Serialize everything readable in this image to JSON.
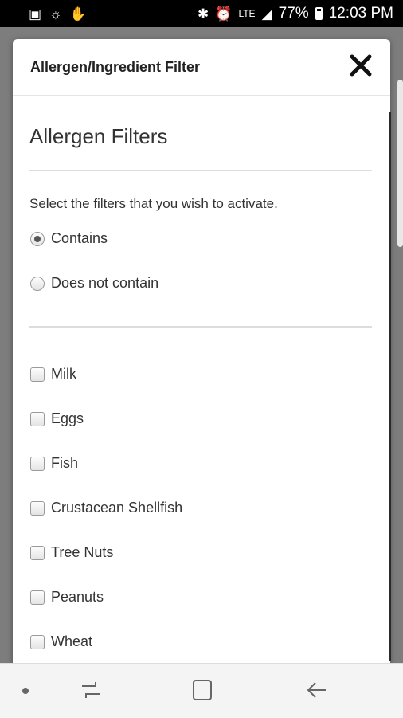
{
  "status_bar": {
    "battery_text": "77%",
    "time": "12:03 PM",
    "network": "LTE"
  },
  "modal": {
    "title": "Allergen/Ingredient Filter",
    "section_title": "Allergen Filters",
    "instructions": "Select the filters that you wish to activate.",
    "match_options": [
      {
        "label": "Contains",
        "checked": true
      },
      {
        "label": "Does not contain",
        "checked": false
      }
    ],
    "allergens": [
      {
        "label": "Milk",
        "checked": false
      },
      {
        "label": "Eggs",
        "checked": false
      },
      {
        "label": "Fish",
        "checked": false
      },
      {
        "label": "Crustacean Shellfish",
        "checked": false
      },
      {
        "label": "Tree Nuts",
        "checked": false
      },
      {
        "label": "Peanuts",
        "checked": false
      },
      {
        "label": "Wheat",
        "checked": false
      }
    ]
  },
  "icons": {
    "close": "close-icon",
    "home": "home-icon",
    "back": "back-icon",
    "recents": "recents-icon"
  }
}
